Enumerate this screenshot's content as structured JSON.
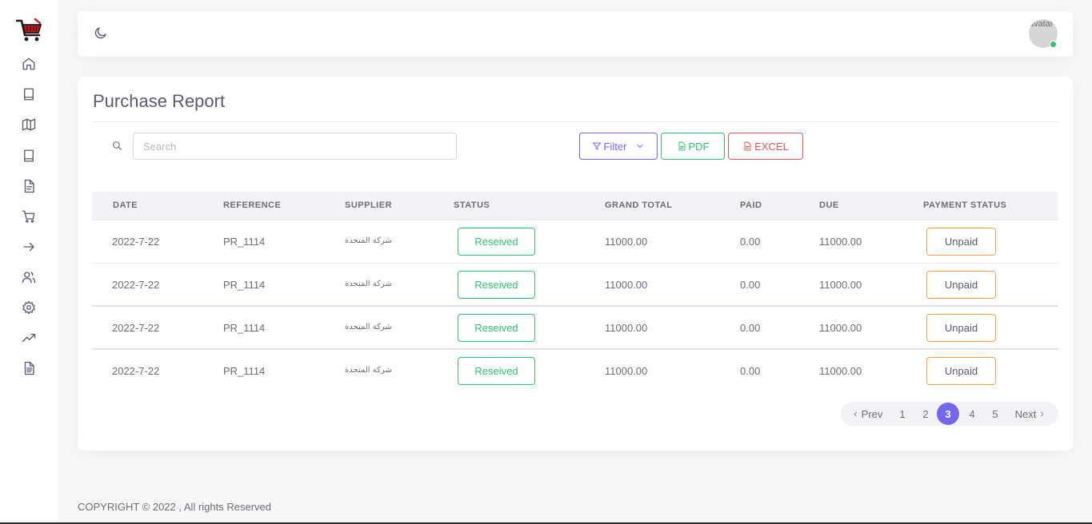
{
  "sidebar": {
    "logo_icon": "shopping-cart-logo-icon",
    "items": [
      {
        "icon": "home-icon"
      },
      {
        "icon": "book-icon"
      },
      {
        "icon": "map-icon"
      },
      {
        "icon": "book-icon"
      },
      {
        "icon": "file-icon"
      },
      {
        "icon": "cart-icon"
      },
      {
        "icon": "arrow-right-icon"
      },
      {
        "icon": "users-icon"
      },
      {
        "icon": "settings-icon"
      },
      {
        "icon": "trending-up-icon"
      },
      {
        "icon": "file-text-icon"
      }
    ]
  },
  "header": {
    "theme_icon": "moon-icon",
    "avatar_alt": "avatar",
    "avatar_status_color": "#28c76f"
  },
  "report": {
    "title": "Purchase Report",
    "search": {
      "placeholder": "Search",
      "value": ""
    },
    "buttons": {
      "filter": "Filter",
      "pdf": "PDF",
      "excel": "EXCEL"
    },
    "columns": [
      "DATE",
      "REFERENCE",
      "SUPPLIER",
      "STATUS",
      "GRAND TOTAL",
      "PAID",
      "DUE",
      "PAYMENT STATUS"
    ],
    "rows": [
      {
        "date": "2022-7-22",
        "reference": "PR_1114",
        "supplier": "شركة المتحدة",
        "status": "Reseived",
        "grand_total": "11000.00",
        "paid": "0.00",
        "due": "11000.00",
        "payment_status": "Unpaid"
      },
      {
        "date": "2022-7-22",
        "reference": "PR_1114",
        "supplier": "شركة المتحدة",
        "status": "Reseived",
        "grand_total": "11000.00",
        "paid": "0.00",
        "due": "11000.00",
        "payment_status": "Unpaid"
      },
      {
        "date": "2022-7-22",
        "reference": "PR_1114",
        "supplier": "شركة المتحدة",
        "status": "Reseived",
        "grand_total": "11000.00",
        "paid": "0.00",
        "due": "11000.00",
        "payment_status": "Unpaid"
      },
      {
        "date": "2022-7-22",
        "reference": "PR_1114",
        "supplier": "شركة المتحدة",
        "status": "Reseived",
        "grand_total": "11000.00",
        "paid": "0.00",
        "due": "11000.00",
        "payment_status": "Unpaid"
      }
    ],
    "pagination": {
      "prev": "Prev",
      "pages": [
        "1",
        "2",
        "3",
        "4",
        "5"
      ],
      "current": "3",
      "next": "Next"
    }
  },
  "colors": {
    "primary": "#7367f0",
    "success": "#28c76f",
    "danger": "#ea5455",
    "warning": "#ff9f43"
  },
  "footer": {
    "copyright": "COPYRIGHT © 2022 , All rights Reserved"
  }
}
